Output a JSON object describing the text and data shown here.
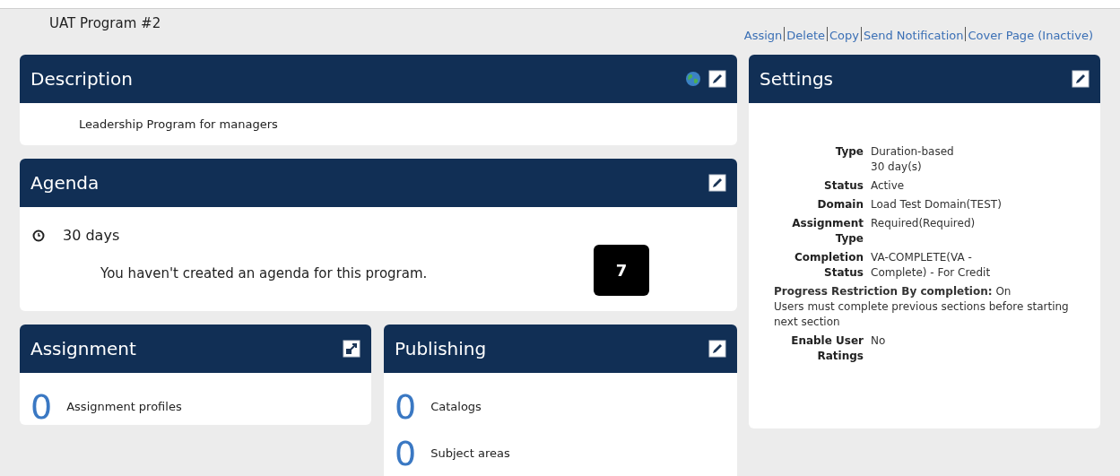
{
  "page_title": "UAT Program #2",
  "actions": [
    "Assign",
    "Delete",
    "Copy",
    "Send Notification",
    "Cover Page (Inactive)"
  ],
  "description": {
    "title": "Description",
    "icons": [
      {
        "kind": "globe"
      },
      {
        "kind": "edit"
      }
    ],
    "text": "Leadership Program for managers"
  },
  "agenda": {
    "title": "Agenda",
    "icons": [
      {
        "kind": "edit"
      }
    ],
    "duration": "30 days",
    "message": "You haven't created an agenda for this program."
  },
  "marker": "7",
  "assignment": {
    "title": "Assignment",
    "icons": [
      {
        "kind": "expand"
      }
    ],
    "counts": [
      {
        "count": "0",
        "label": "Assignment profiles"
      }
    ]
  },
  "publishing": {
    "title": "Publishing",
    "icons": [
      {
        "kind": "edit"
      }
    ],
    "counts": [
      {
        "count": "0",
        "label": "Catalogs"
      },
      {
        "count": "0",
        "label": "Subject areas"
      }
    ]
  },
  "settings": {
    "title": "Settings",
    "icons": [
      {
        "kind": "edit"
      }
    ],
    "rows": [
      {
        "label": "Type",
        "value": "Duration-based\n30 day(s)"
      },
      {
        "label": "Status",
        "value": "Active"
      },
      {
        "label": "Domain",
        "value": "Load Test Domain(TEST)"
      },
      {
        "label": "Assignment Type",
        "value": "Required(Required)"
      },
      {
        "label": "Completion Status",
        "value": "VA-COMPLETE(VA - Complete) - For Credit"
      }
    ],
    "restriction": "**Progress Restriction By completion:** On",
    "restriction_note": "Users must complete previous sections before starting next section",
    "rows_after": [
      {
        "label": "Enable User Ratings",
        "value": "No"
      }
    ]
  }
}
